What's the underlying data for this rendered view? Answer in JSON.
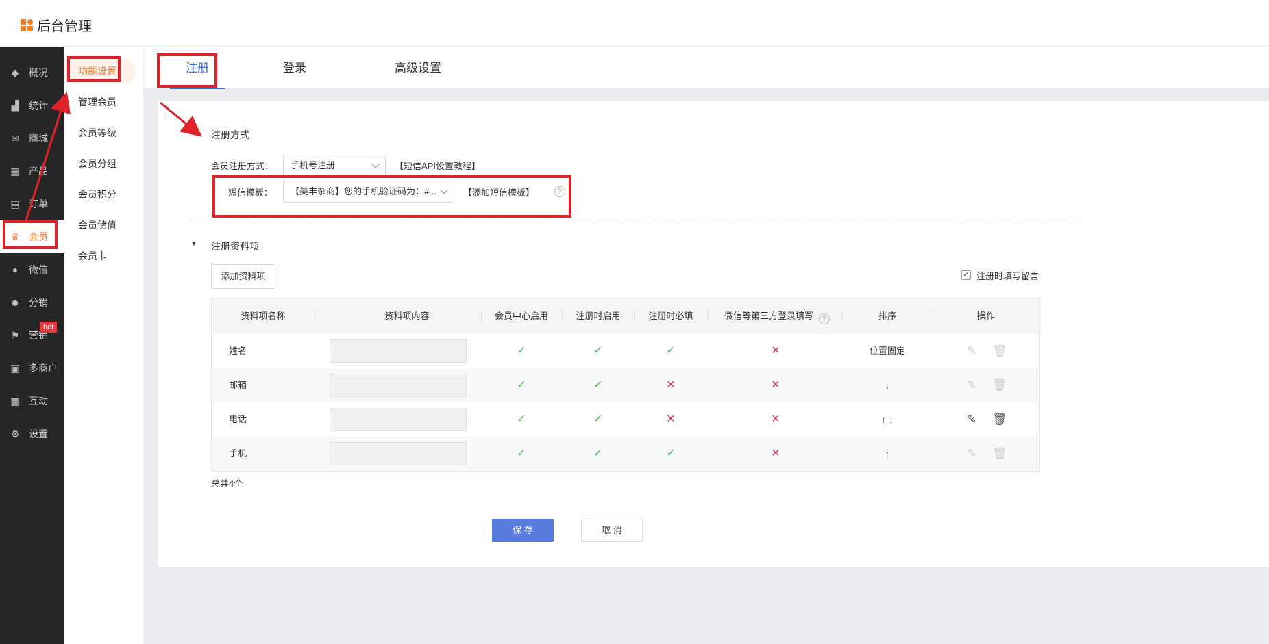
{
  "app": {
    "title": "后台管理"
  },
  "sidebar": {
    "items": [
      {
        "label": "概况",
        "icon": "layers-icon"
      },
      {
        "label": "统计",
        "icon": "chart-icon"
      },
      {
        "label": "商城",
        "icon": "mail-icon"
      },
      {
        "label": "产品",
        "icon": "grid-icon"
      },
      {
        "label": "订单",
        "icon": "clipboard-icon"
      },
      {
        "label": "会员",
        "icon": "crown-icon",
        "active": true
      },
      {
        "label": "微信",
        "icon": "chat-icon"
      },
      {
        "label": "分销",
        "icon": "users-icon"
      },
      {
        "label": "营销",
        "icon": "flag-icon",
        "badge": "hot"
      },
      {
        "label": "多商户",
        "icon": "stores-icon"
      },
      {
        "label": "互动",
        "icon": "interact-icon"
      },
      {
        "label": "设置",
        "icon": "gear-icon"
      }
    ]
  },
  "subnav": {
    "items": [
      "功能设置",
      "管理会员",
      "会员等级",
      "会员分组",
      "会员积分",
      "会员储值",
      "会员卡"
    ]
  },
  "tabs": [
    "注册",
    "登录",
    "高级设置"
  ],
  "register": {
    "section_title": "注册方式",
    "method_label": "会员注册方式：",
    "method_value": "手机号注册",
    "method_link": "【短信API设置教程】",
    "sms_label": "短信模板：",
    "sms_value": "【美丰杂商】您的手机验证码为：#...",
    "sms_link": "【添加短信模板】",
    "help_glyph": "?"
  },
  "profile": {
    "section_title": "注册资料项",
    "add_button": "添加资料项",
    "message_checkbox_label": "注册时填写留言",
    "message_checked": true,
    "total": "总共4个"
  },
  "table": {
    "headers": [
      "资料项名称",
      "资料项内容",
      "会员中心启用",
      "注册时启用",
      "注册时必填",
      "微信等第三方登录填写",
      "排序",
      "操作"
    ],
    "rows": [
      {
        "name": "姓名",
        "center": "✓",
        "reg_enable": "✓",
        "reg_required": "✓",
        "third_party": "✕",
        "sort": "位置固定",
        "editable": false
      },
      {
        "name": "邮箱",
        "center": "✓",
        "reg_enable": "✓",
        "reg_required": "✕",
        "third_party": "✕",
        "sort": "↓",
        "editable": false
      },
      {
        "name": "电话",
        "center": "✓",
        "reg_enable": "✓",
        "reg_required": "✕",
        "third_party": "✕",
        "sort": "↑ ↓",
        "editable": true
      },
      {
        "name": "手机",
        "center": "✓",
        "reg_enable": "✓",
        "reg_required": "✓",
        "third_party": "✕",
        "sort": "↑",
        "editable": false
      }
    ]
  },
  "actions": {
    "save": "保 存",
    "cancel": "取 消"
  },
  "colors": {
    "accent": "#f07a35",
    "primary": "#5a7be0",
    "annotation": "#e0222a",
    "ok": "#52b25b",
    "no": "#d8355a"
  }
}
